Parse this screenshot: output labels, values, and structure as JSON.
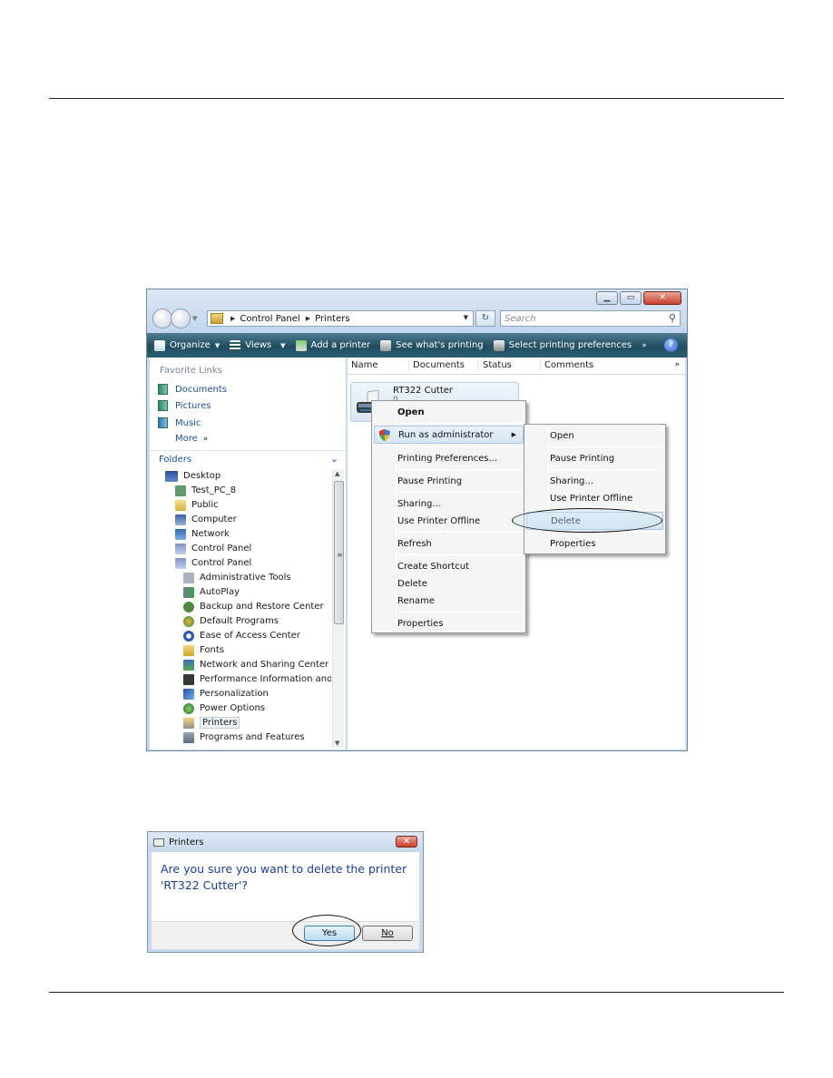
{
  "window": {
    "caption": {
      "minimize_icon": "minimize-icon",
      "maximize_icon": "maximize-icon",
      "close_icon": "close-icon"
    },
    "address": {
      "crumbs": [
        "Control Panel",
        "Printers"
      ]
    },
    "search": {
      "placeholder": "Search"
    },
    "toolbar": {
      "organize": "Organize",
      "views": "Views",
      "add_printer": "Add a printer",
      "see_printing": "See what's printing",
      "select_prefs": "Select printing preferences",
      "overflow": "»",
      "help": "?"
    },
    "favorites": {
      "title": "Favorite Links",
      "items": [
        "Documents",
        "Pictures",
        "Music"
      ],
      "more": "More"
    },
    "folders": {
      "title": "Folders",
      "tree": [
        "Desktop",
        "Test_PC_8",
        "Public",
        "Computer",
        "Network",
        "Control Panel",
        "Control Panel",
        "Administrative Tools",
        "AutoPlay",
        "Backup and Restore Center",
        "Default Programs",
        "Ease of Access Center",
        "Fonts",
        "Network and Sharing Center",
        "Performance Information and To",
        "Personalization",
        "Power Options",
        "Printers",
        "Programs and Features"
      ],
      "selected": "Printers"
    },
    "columns": [
      "Name",
      "Documents",
      "Status",
      "Comments"
    ],
    "printer": {
      "name": "RT322 Cutter",
      "documents": "0"
    }
  },
  "context_menu": {
    "items": [
      "Open",
      "Run as administrator",
      "Printing Preferences...",
      "Pause Printing",
      "Sharing...",
      "Use Printer Offline",
      "Refresh",
      "Create Shortcut",
      "Delete",
      "Rename",
      "Properties"
    ]
  },
  "submenu": {
    "items": [
      "Open",
      "Pause Printing",
      "Sharing...",
      "Use Printer Offline",
      "Delete",
      "Properties"
    ],
    "highlighted": "Delete"
  },
  "dialog": {
    "title": "Printers",
    "message": "Are you sure you want to delete the printer 'RT322 Cutter'?",
    "yes": "Yes",
    "no": "No",
    "close": "×"
  }
}
